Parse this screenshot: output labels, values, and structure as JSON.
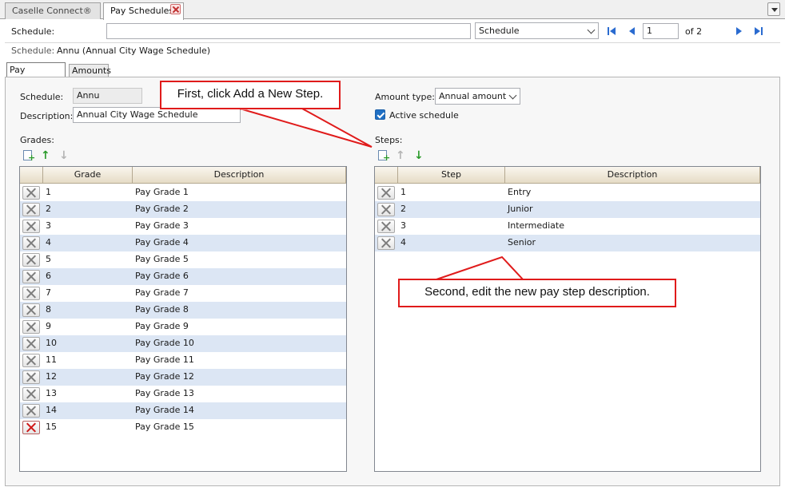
{
  "tabs": [
    {
      "label": "Caselle Connect®",
      "active": false
    },
    {
      "label": "Pay Schedules",
      "active": true
    }
  ],
  "schedule_bar": {
    "label": "Schedule:",
    "search_value": "",
    "lookup_value": "Schedule",
    "page_value": "1",
    "page_total": "of 2"
  },
  "current": {
    "label": "Schedule:",
    "value": "Annu (Annual City Wage Schedule)"
  },
  "inner_tabs": [
    "Pay Schedule",
    "Amounts"
  ],
  "form": {
    "schedule_label": "Schedule:",
    "schedule_value": "Annu",
    "description_label": "Description:",
    "description_value": "Annual City Wage Schedule",
    "amount_type_label": "Amount type:",
    "amount_type_value": "Annual amount",
    "active_label": "Active schedule",
    "active_checked": true
  },
  "grades": {
    "label": "Grades:",
    "columns": [
      "Grade",
      "Description"
    ],
    "rows": [
      {
        "code": "1",
        "desc": "Pay Grade 1"
      },
      {
        "code": "2",
        "desc": "Pay Grade 2"
      },
      {
        "code": "3",
        "desc": "Pay Grade 3"
      },
      {
        "code": "4",
        "desc": "Pay Grade 4"
      },
      {
        "code": "5",
        "desc": "Pay Grade 5"
      },
      {
        "code": "6",
        "desc": "Pay Grade 6"
      },
      {
        "code": "7",
        "desc": "Pay Grade 7"
      },
      {
        "code": "8",
        "desc": "Pay Grade 8"
      },
      {
        "code": "9",
        "desc": "Pay Grade 9"
      },
      {
        "code": "10",
        "desc": "Pay Grade 10"
      },
      {
        "code": "11",
        "desc": "Pay Grade 11"
      },
      {
        "code": "12",
        "desc": "Pay Grade 12"
      },
      {
        "code": "13",
        "desc": "Pay Grade 13"
      },
      {
        "code": "14",
        "desc": "Pay Grade 14"
      },
      {
        "code": "15",
        "desc": "Pay Grade 15"
      }
    ]
  },
  "steps": {
    "label": "Steps:",
    "columns": [
      "Step",
      "Description"
    ],
    "rows": [
      {
        "code": "1",
        "desc": "Entry"
      },
      {
        "code": "2",
        "desc": "Junior"
      },
      {
        "code": "3",
        "desc": "Intermediate"
      },
      {
        "code": "4",
        "desc": "Senior"
      }
    ]
  },
  "callouts": {
    "first": "First, click Add a New Step.",
    "second": "Second, edit the new pay step description."
  },
  "colors": {
    "accent": "#2a6bd0",
    "row_alt": "#dce6f4",
    "callout": "#e01b1b"
  }
}
